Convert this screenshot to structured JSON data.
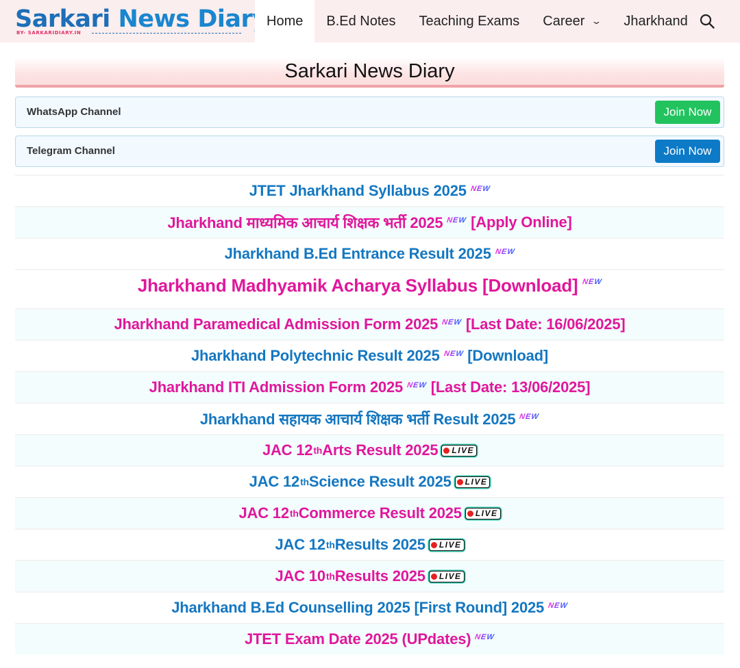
{
  "logo": {
    "title_part1": "Sarkari ",
    "title_part2": "News Diary",
    "by_line": "BY- SARKARIDIARY.IN"
  },
  "nav": {
    "items": [
      {
        "label": "Home"
      },
      {
        "label": "B.Ed Notes"
      },
      {
        "label": "Teaching Exams"
      },
      {
        "label": "Career"
      },
      {
        "label": "Jharkhand"
      }
    ],
    "search_icon": "search-icon"
  },
  "headline": "Sarkari News Diary",
  "channels": {
    "whatsapp": {
      "label": "WhatsApp Channel",
      "button": "Join Now",
      "color": "#22c35e"
    },
    "telegram": {
      "label": "Telegram Channel",
      "button": "Join Now",
      "color": "#0d7ac7"
    }
  },
  "badges": {
    "new": "NEW",
    "live": "LIVE"
  },
  "links": [
    {
      "text": "JTET Jharkhand Syllabus 2025",
      "after": ""
    },
    {
      "text": "Jharkhand माध्यमिक आचार्य शिक्षक भर्ती 2025",
      "after": "[Apply Online]"
    },
    {
      "text": "Jharkhand B.Ed Entrance Result 2025",
      "after": ""
    },
    {
      "text": "Jharkhand Madhyamik Acharya Syllabus [Download]",
      "after": ""
    },
    {
      "text": "Jharkhand Paramedical Admission Form 2025",
      "after": "[Last Date: 16/06/2025]"
    },
    {
      "text": "Jharkhand Polytechnic Result 2025",
      "after": "[Download]"
    },
    {
      "text": "Jharkhand ITI Admission Form 2025",
      "after": "[Last Date: 13/06/2025]"
    },
    {
      "text": "Jharkhand सहायक आचार्य शिक्षक भर्ती Result 2025",
      "after": ""
    },
    {
      "pre": "JAC 12",
      "sup": "th",
      "post": " Arts Result 2025"
    },
    {
      "pre": "JAC 12",
      "sup": "th",
      "post": " Science Result 2025"
    },
    {
      "pre": "JAC 12",
      "sup": "th",
      "post": " Commerce Result 2025"
    },
    {
      "pre": "JAC 12",
      "sup": "th",
      "post": " Results 2025"
    },
    {
      "pre": "JAC 10",
      "sup": "th",
      "post": " Results 2025"
    },
    {
      "text": "Jharkhand B.Ed Counselling 2025 [First Round] 2025",
      "after": ""
    },
    {
      "text": "JTET Exam Date 2025 (UPdates)",
      "after": ""
    }
  ],
  "colors": {
    "link_blue": "#1477c1",
    "link_pink": "#e0179b",
    "topbar_bg": "#fbeeee"
  }
}
